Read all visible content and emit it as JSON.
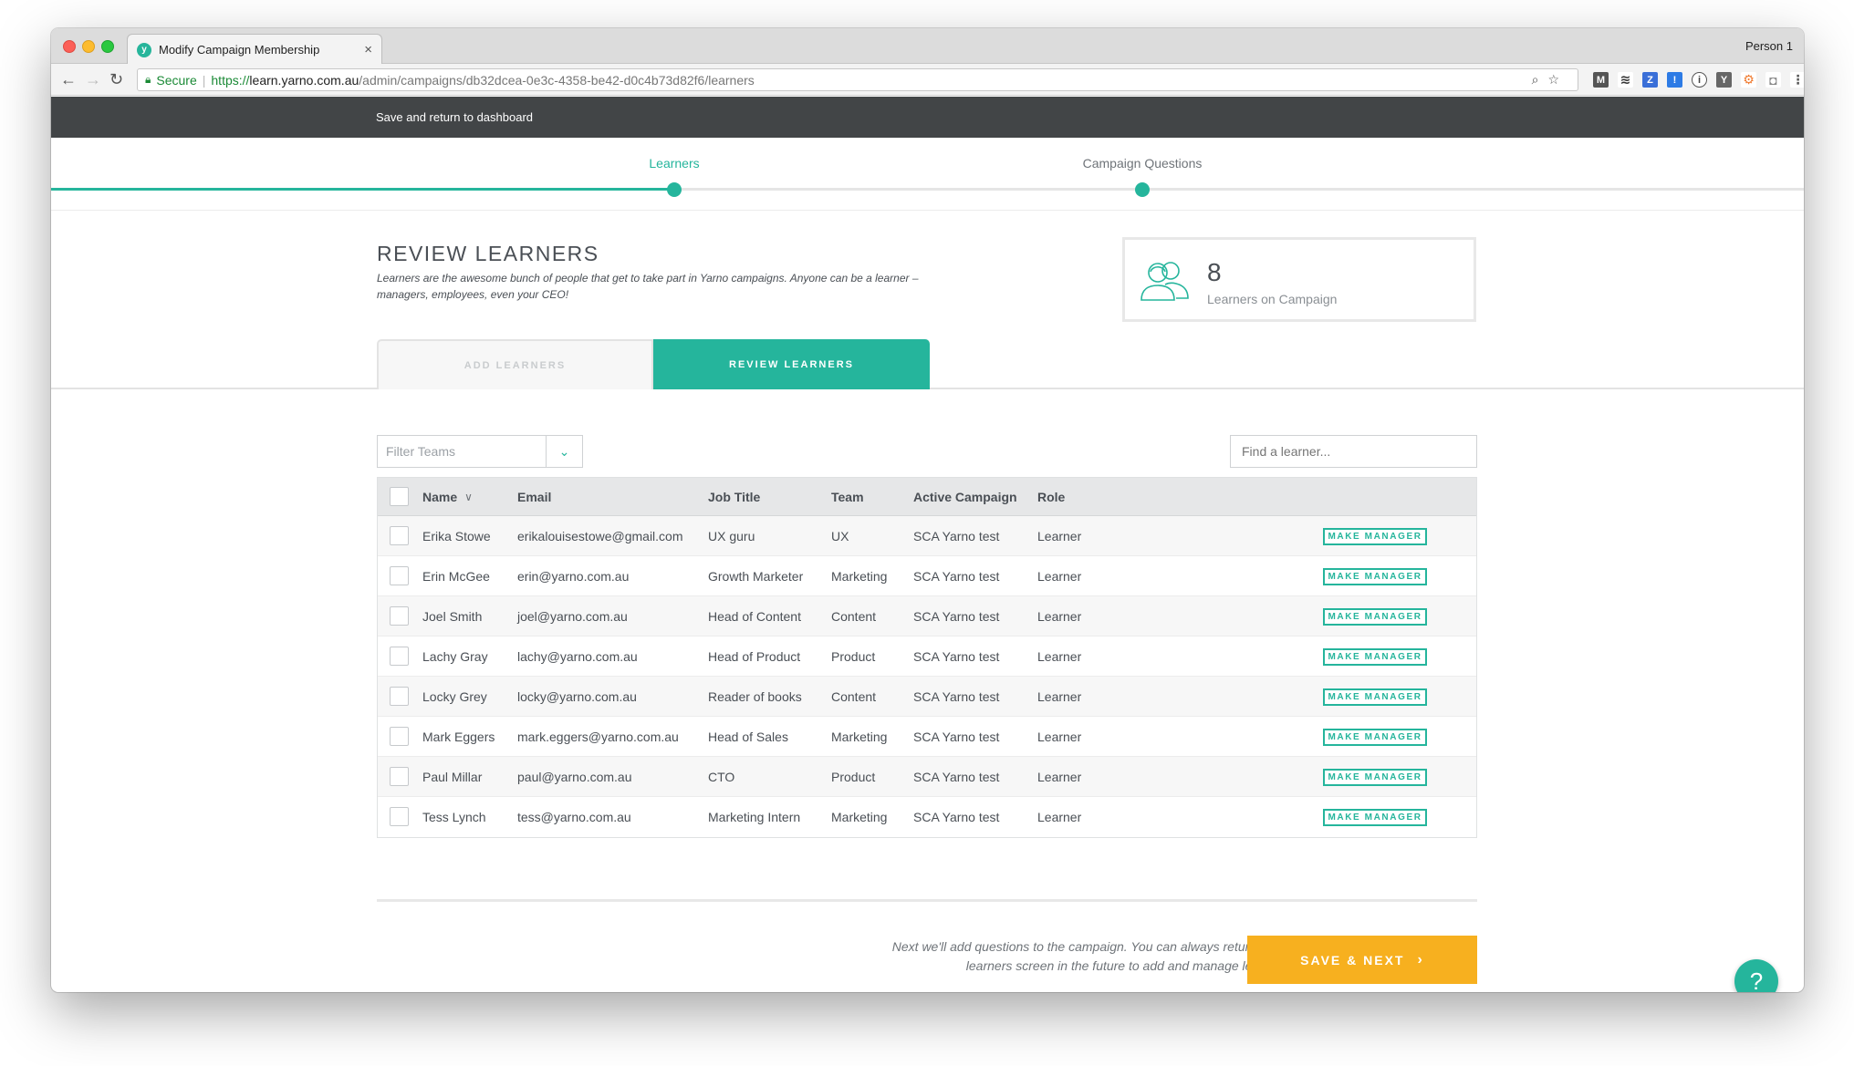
{
  "browser": {
    "tab_title": "Modify Campaign Membership",
    "favicon_letter": "y",
    "profile": "Person 1",
    "secure_label": "Secure",
    "url_scheme": "https://",
    "url_host": "learn.yarno.com.au",
    "url_path": "/admin/campaigns/db32dcea-0e3c-4358-be42-d0c4b73d82f6/learners"
  },
  "header": {
    "save_return": "Save and return to dashboard"
  },
  "stepper": {
    "steps": [
      {
        "label": "Learners",
        "active": true
      },
      {
        "label": "Campaign Questions",
        "active": false
      }
    ]
  },
  "page": {
    "title": "REVIEW LEARNERS",
    "description": "Learners are the awesome bunch of people that get to take part in Yarno campaigns. Anyone can be a learner – managers, employees, even your CEO!"
  },
  "summary": {
    "count": "8",
    "label": "Learners on Campaign"
  },
  "tabs": {
    "add": "ADD LEARNERS",
    "review": "REVIEW LEARNERS"
  },
  "filters": {
    "teams_placeholder": "Filter Teams",
    "search_placeholder": "Find a learner..."
  },
  "table": {
    "headers": {
      "name": "Name",
      "email": "Email",
      "job": "Job Title",
      "team": "Team",
      "campaign": "Active Campaign",
      "role": "Role"
    },
    "action_label": "MAKE MANAGER",
    "rows": [
      {
        "name": "Erika Stowe",
        "email": "erikalouisestowe@gmail.com",
        "job": "UX guru",
        "team": "UX",
        "campaign": "SCA Yarno test",
        "role": "Learner"
      },
      {
        "name": "Erin McGee",
        "email": "erin@yarno.com.au",
        "job": "Growth Marketer",
        "team": "Marketing",
        "campaign": "SCA Yarno test",
        "role": "Learner"
      },
      {
        "name": "Joel Smith",
        "email": "joel@yarno.com.au",
        "job": "Head of Content",
        "team": "Content",
        "campaign": "SCA Yarno test",
        "role": "Learner"
      },
      {
        "name": "Lachy Gray",
        "email": "lachy@yarno.com.au",
        "job": "Head of Product",
        "team": "Product",
        "campaign": "SCA Yarno test",
        "role": "Learner"
      },
      {
        "name": "Locky Grey",
        "email": "locky@yarno.com.au",
        "job": "Reader of books",
        "team": "Content",
        "campaign": "SCA Yarno test",
        "role": "Learner"
      },
      {
        "name": "Mark Eggers",
        "email": "mark.eggers@yarno.com.au",
        "job": "Head of Sales",
        "team": "Marketing",
        "campaign": "SCA Yarno test",
        "role": "Learner"
      },
      {
        "name": "Paul Millar",
        "email": "paul@yarno.com.au",
        "job": "CTO",
        "team": "Product",
        "campaign": "SCA Yarno test",
        "role": "Learner"
      },
      {
        "name": "Tess Lynch",
        "email": "tess@yarno.com.au",
        "job": "Marketing Intern",
        "team": "Marketing",
        "campaign": "SCA Yarno test",
        "role": "Learner"
      }
    ]
  },
  "footer": {
    "note_line1": "Next we'll add questions to the campaign. You can always return to the",
    "note_line2": "learners screen in the future to add and manage learners.",
    "save_next": "SAVE & NEXT",
    "help": "?"
  },
  "colors": {
    "accent": "#25b59c",
    "cta": "#f7b01f",
    "header": "#424547"
  }
}
